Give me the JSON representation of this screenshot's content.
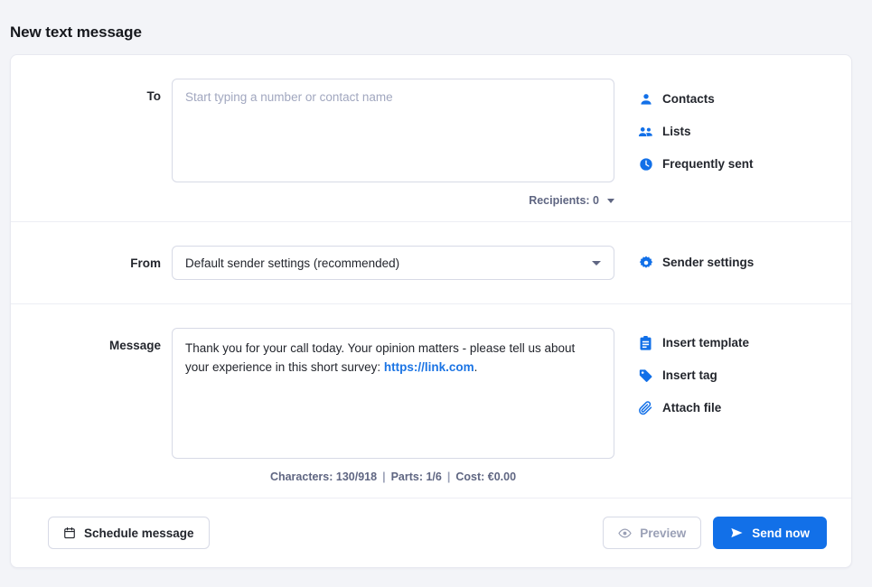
{
  "page": {
    "title": "New text message"
  },
  "to": {
    "label": "To",
    "placeholder": "Start typing a number or contact name",
    "value": "",
    "recipients_label": "Recipients: 0",
    "actions": [
      {
        "label": "Contacts",
        "icon": "person-icon"
      },
      {
        "label": "Lists",
        "icon": "people-icon"
      },
      {
        "label": "Frequently sent",
        "icon": "clock-icon"
      }
    ]
  },
  "from": {
    "label": "From",
    "selected": "Default sender settings (recommended)",
    "actions": [
      {
        "label": "Sender settings",
        "icon": "gear-icon"
      }
    ]
  },
  "message": {
    "label": "Message",
    "text_before_link": "Thank you for your call today. Your opinion matters - please tell us about your experience in this short survey: ",
    "link_text": "https://link.com",
    "text_after_link": ".",
    "counter": {
      "characters": "Characters: 130/918",
      "separator": "|",
      "parts": "Parts: 1/6",
      "cost": "Cost: €0.00"
    },
    "actions": [
      {
        "label": "Insert template",
        "icon": "clipboard-icon"
      },
      {
        "label": "Insert tag",
        "icon": "tag-icon"
      },
      {
        "label": "Attach file",
        "icon": "paperclip-icon"
      }
    ]
  },
  "footer": {
    "schedule_label": "Schedule message",
    "preview_label": "Preview",
    "send_label": "Send now"
  },
  "colors": {
    "accent": "#1270e8",
    "link": "#1b74e4",
    "page_bg": "#f3f4f8",
    "muted_text": "#5f6682",
    "placeholder": "#a1a7bf",
    "border": "#d7dae6"
  }
}
